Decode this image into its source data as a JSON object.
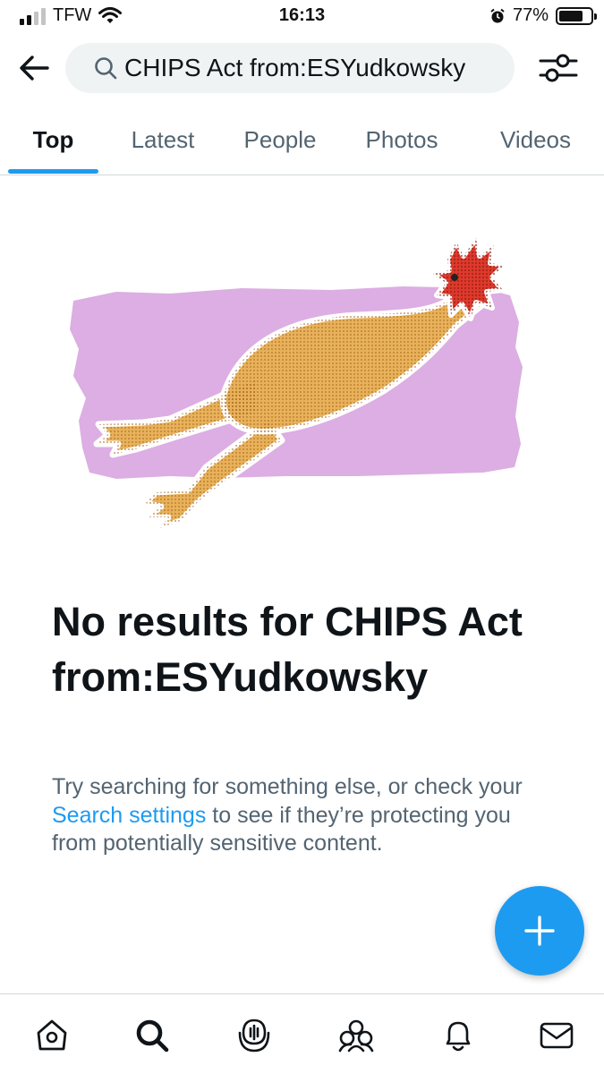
{
  "status_bar": {
    "carrier": "TFW",
    "time": "16:13",
    "battery": "77%",
    "battery_level": 0.77,
    "signal_bars_filled": 2,
    "signal_bars_total": 4
  },
  "header": {
    "search_query": "CHIPS Act from:ESYudkowsky"
  },
  "tabs": [
    {
      "label": "Top",
      "active": true
    },
    {
      "label": "Latest",
      "active": false
    },
    {
      "label": "People",
      "active": false
    },
    {
      "label": "Photos",
      "active": false
    },
    {
      "label": "Videos",
      "active": false
    }
  ],
  "empty_state": {
    "title": "No results for CHIPS Act from:ESYudkowsky",
    "body_before_link": "Try searching for something else, or check your ",
    "link_text": "Search settings",
    "body_after_link": " to see if they’re protecting you from potentially sensitive content."
  },
  "icons": {
    "back": "back-arrow-icon",
    "search": "search-icon",
    "filter": "filter-sliders-icon",
    "compose": "plus-icon",
    "nav": [
      "home-icon",
      "search-icon",
      "spaces-icon",
      "communities-icon",
      "notifications-icon",
      "messages-icon"
    ]
  },
  "colors": {
    "accent": "#1d9bf0",
    "text_primary": "#0f1419",
    "text_secondary": "#536471",
    "illustration_bg": "#dcaee3",
    "chicken_body": "#e8b25a",
    "chicken_comb": "#e03a2c"
  }
}
